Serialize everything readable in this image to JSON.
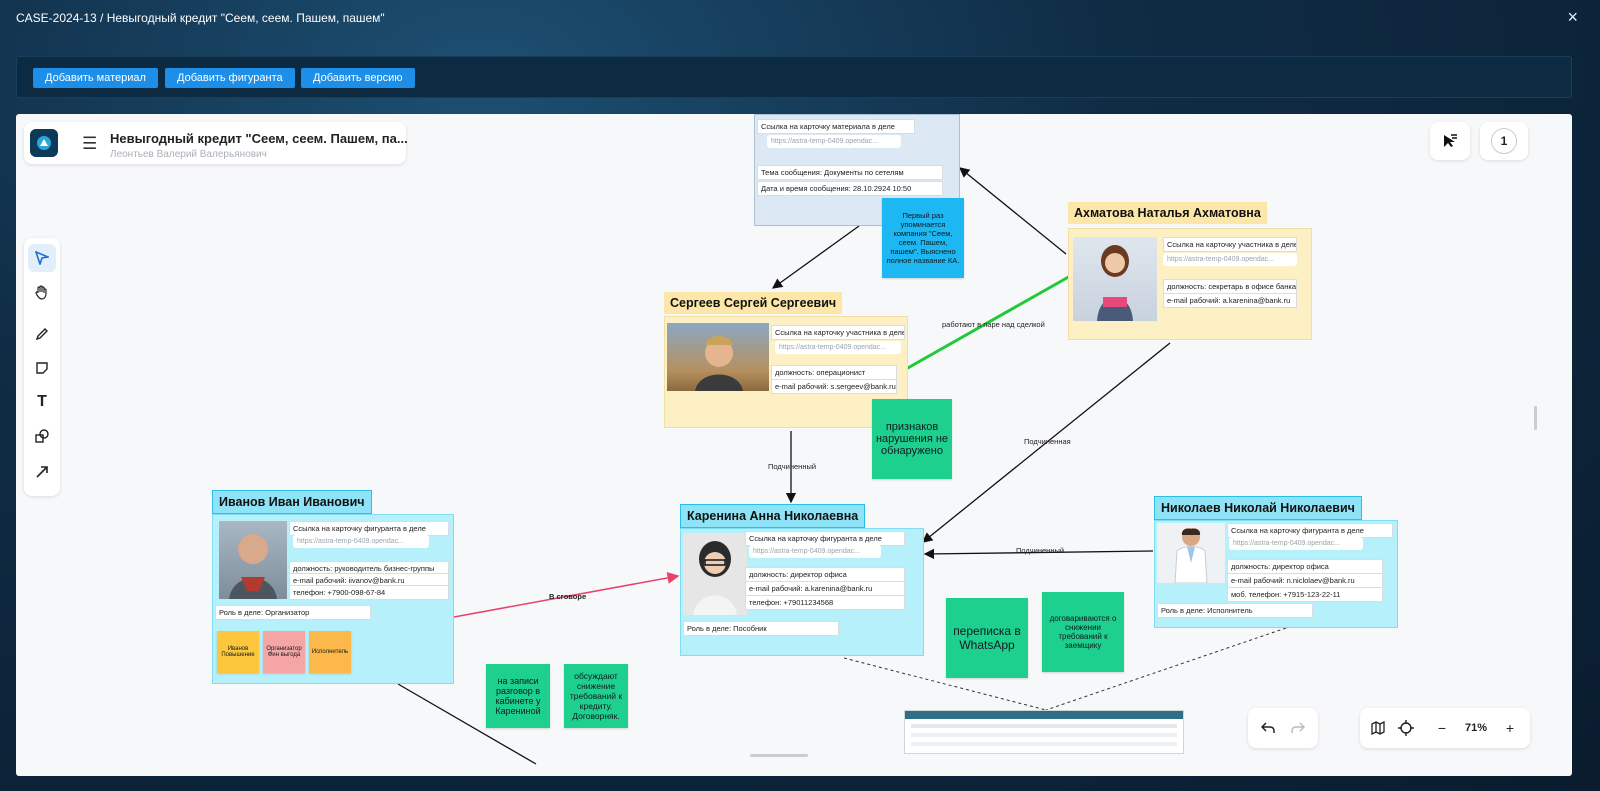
{
  "window": {
    "title": "CASE-2024-13 / Невыгодный кредит \"Сеем, сеем. Пашем, пашем\"",
    "close_label": "×"
  },
  "toolbar": {
    "add_material": "Добавить материал",
    "add_person": "Добавить фигуранта",
    "add_version": "Добавить версию"
  },
  "board": {
    "title": "Невыгодный кредит \"Сеем, сеем. Пашем, па...",
    "author": "Леонтьев Валерий Валерьянович",
    "participants_count": "1",
    "zoom": "71%"
  },
  "material": {
    "link_label": "Ссылка на карточку материала в деле",
    "link_url": "https://astra-temp-0409.opendac...",
    "subject": "Тема сообщения: Документы по сетелям",
    "datetime": "Дата и время сообщения: 28.10.2924 10:50"
  },
  "persons": {
    "akhmatova": {
      "name": "Ахматова Наталья Ахматовна",
      "link_label": "Ссылка на карточку участника в деле",
      "link_url": "https://astra-temp-0409.opendac...",
      "position": "должность: секретарь в офисе банка",
      "email": "e-mail рабочий: a.karenina@bank.ru"
    },
    "sergeev": {
      "name": "Сергеев Сергей Сергеевич",
      "link_label": "Ссылка на карточку участника в деле",
      "link_url": "https://astra-temp-0409.opendac...",
      "position": "должность: операционист",
      "email": "e-mail рабочий: s.sergeev@bank.ru"
    },
    "ivanov": {
      "name": "Иванов Иван Иванович",
      "link_label": "Ссылка на карточку фигуранта в деле",
      "link_url": "https://astra-temp-0409.opendac...",
      "position": "должность: руководитель бизнес-группы",
      "email": "e-mail рабочий: iivanov@bank.ru",
      "phone": "телефон: +7900-098-67-84",
      "role": "Роль в деле: Организатор",
      "tags": [
        "Иванов Повышение",
        "Организатор Фин выгода",
        "Исполнитель"
      ]
    },
    "karenina": {
      "name": "Каренина Анна Николаевна",
      "link_label": "Ссылка на карточку фигуранта в деле",
      "link_url": "https://astra-temp-0409.opendac...",
      "position": "должность: директор офиса",
      "email": "e-mail рабочий: a.karenina@bank.ru",
      "phone": "телефон: +79011234568",
      "role": "Роль в деле: Пособник"
    },
    "nikolaev": {
      "name": "Николаев Николай Николаевич",
      "link_label": "Ссылка на карточку фигуранта в деле",
      "link_url": "https://astra-temp-0409.opendac...",
      "position": "должность: директор офиса",
      "email": "e-mail рабочий: n.niclolaev@bank.ru",
      "phone": "моб. телефон:  +7915-123-22-11",
      "role": "Роль в деле: Исполнитель"
    }
  },
  "notes": {
    "first_mention": "Первый раз упоминается компания \"Сеем, сеем. Пашем, пашем\". Выяснено полное название КА.",
    "no_violations": "признаков нарушения не обнаружено",
    "whatsapp": "переписка в WhatsApp",
    "agree": "договариваются о снижении требований к заемщику",
    "recording": "на записи разговор в кабинете у Карениной",
    "discuss": "обсуждают снижение требований к кредиту. Договорняк."
  },
  "edges": {
    "work_pair": "работают в паре над сделкой",
    "subordinate_1": "Подчиненный",
    "subordinate_2": "Подчиненная",
    "subordinate_3": "Подчиненный",
    "collusion": "В сговоре"
  },
  "colors": {
    "accent": "#1e8fe8",
    "card_blue": "#b5f0fb",
    "card_yellow": "#fdf0c4",
    "note_cyan": "#1db8f3",
    "note_green": "#1ed08e",
    "edge_green": "#20c93a",
    "edge_pink": "#e9416c"
  },
  "icons": {
    "select": "cursor-icon",
    "hand": "hand-icon",
    "pen": "pencil-icon",
    "sticky": "sticky-note-icon",
    "text": "text-icon",
    "shape": "shapes-icon",
    "arrow": "arrow-icon"
  }
}
